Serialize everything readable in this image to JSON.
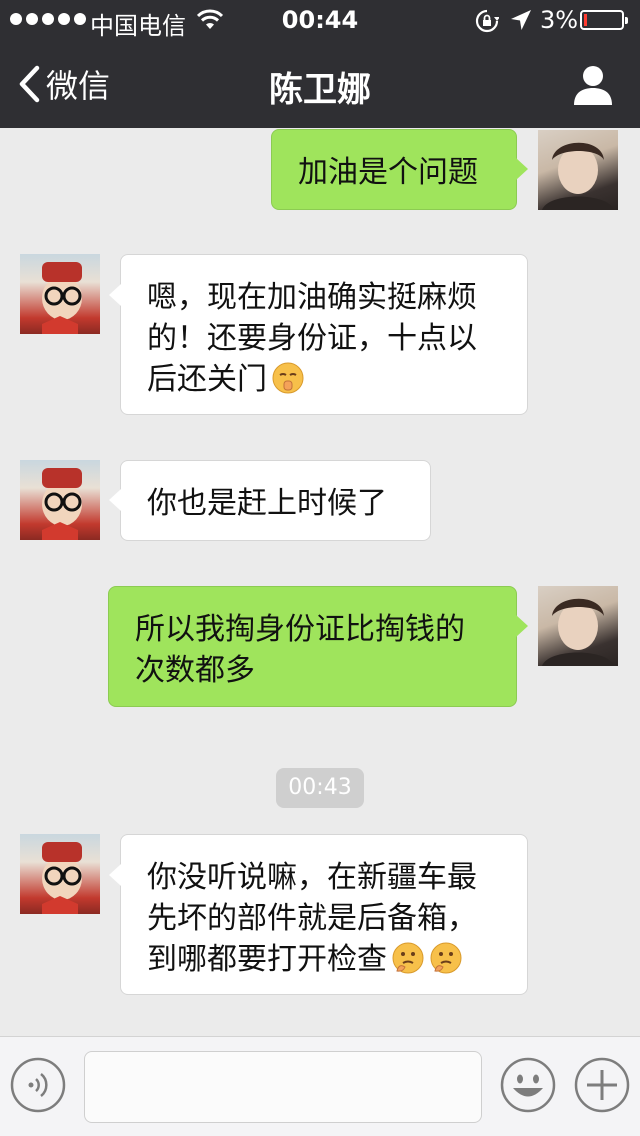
{
  "status_bar": {
    "carrier": "中国电信",
    "time": "00:44",
    "battery_percent": "3%",
    "battery_level": 0.03,
    "signal_icon": "signal-dots-icon",
    "wifi_icon": "wifi-icon",
    "rotation_lock_icon": "rotation-lock-icon",
    "location_icon": "location-arrow-icon"
  },
  "nav": {
    "back_label": "微信",
    "title": "陈卫娜",
    "back_icon": "chevron-left-icon",
    "profile_icon": "person-icon"
  },
  "messages": [
    {
      "from": "self",
      "text": "加油是个问题"
    },
    {
      "from": "other",
      "text": "嗯，现在加油确实挺麻烦的！还要身份证，十点以后还关门",
      "emoji": "shushing-face-icon"
    },
    {
      "from": "other",
      "text": "你也是赶上时候了"
    },
    {
      "from": "self",
      "text": "所以我掏身份证比掏钱的次数都多"
    },
    {
      "from": "other",
      "text": "你没听说嘛，在新疆车最先坏的部件就是后备箱，到哪都要打开检查",
      "emoji": "thinking-face-icon"
    }
  ],
  "timestamp": "00:43",
  "input_bar": {
    "voice_icon": "voice-icon",
    "emoji_icon": "smiley-face-icon",
    "plus_icon": "plus-icon",
    "text_value": ""
  },
  "colors": {
    "header_bg": "#2f2f33",
    "chat_bg": "#ebebeb",
    "self_bubble": "#9fe45c",
    "other_bubble": "#ffffff",
    "timestamp_bg": "#cfcfcf"
  }
}
